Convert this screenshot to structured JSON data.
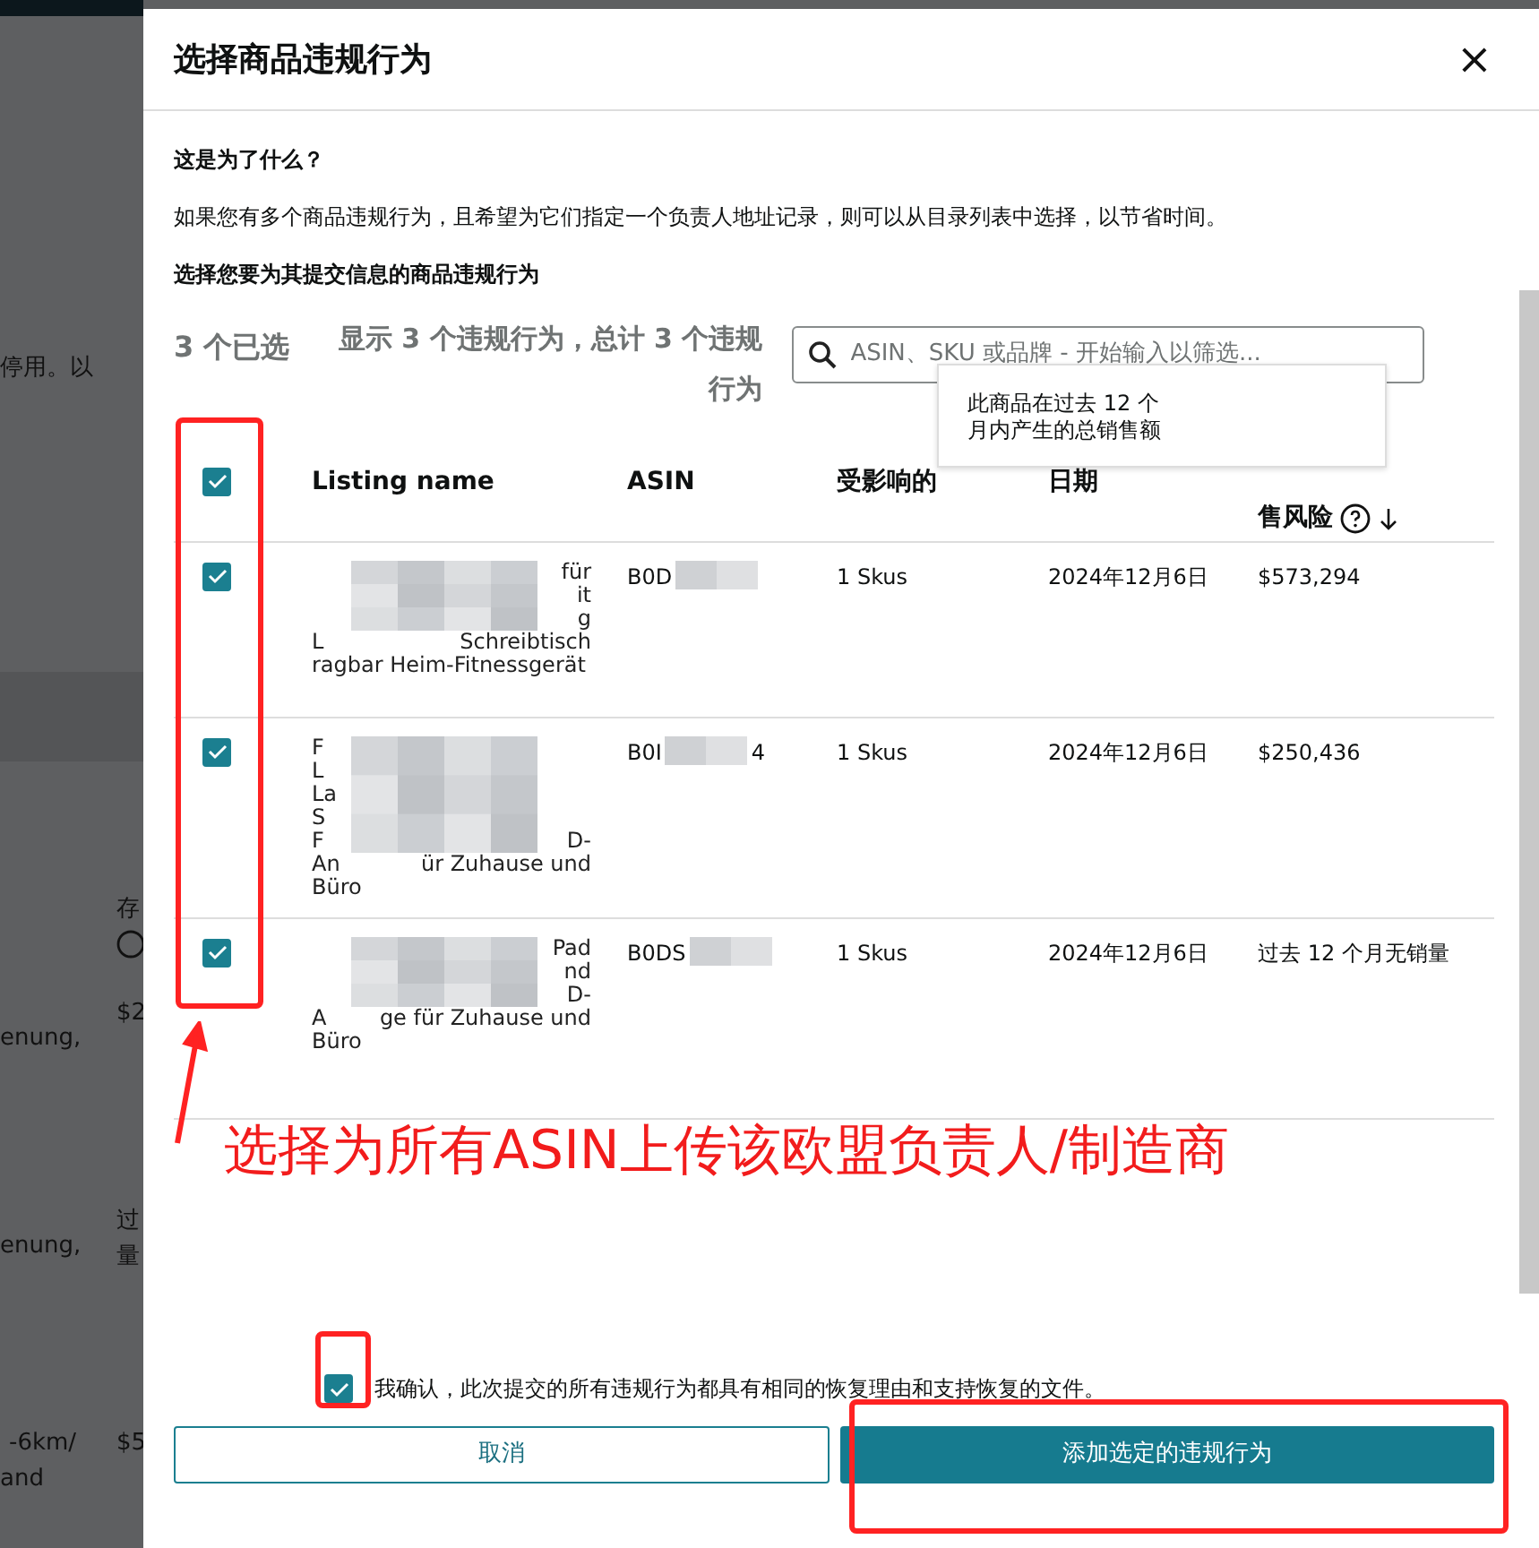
{
  "background_page": {
    "fragments": [
      {
        "text": "停用。以"
      },
      {
        "text": "存"
      },
      {
        "text": "$2"
      },
      {
        "text": "enung,"
      },
      {
        "text": "过"
      },
      {
        "text": "enung,"
      },
      {
        "text": "量"
      },
      {
        "text": "-6km/"
      },
      {
        "text": "$5"
      },
      {
        "text": "and"
      }
    ]
  },
  "modal": {
    "title": "选择商品违规行为",
    "close": "×",
    "why_heading": "这是为了什么？",
    "why_text": "如果您有多个商品违规行为，且希望为它们指定一个负责人地址记录，则可以从目录列表中选择，以节省时间。",
    "select_heading": "选择您要为其提交信息的商品违规行为",
    "selected_count": "3 个已选",
    "showing_count": "显示 3 个违规行为，总计 3 个违规行为",
    "search": {
      "placeholder": "ASIN、SKU 或品牌 - 开始输入以筛选..."
    },
    "tooltip": {
      "lines": [
        "此商品在过去 12 个",
        "月内产生的总销售额"
      ]
    },
    "table": {
      "select_all": {
        "checked": true
      },
      "columns": [
        "Listing name",
        "ASIN",
        "受影响的",
        "日期",
        "售风险"
      ],
      "rows": [
        {
          "checked": true,
          "name_lines": [
            {
              "tail": "für"
            },
            {
              "tail": "it"
            },
            {
              "tail": "g"
            },
            {
              "head": "L",
              "tail": "Schreibtisch"
            },
            {
              "head": "ragbar Heim-Fitnessgerät"
            }
          ],
          "asin": {
            "head": "B0D"
          },
          "skus": "1 Skus",
          "date": "2024年12月6日",
          "risk": "$573,294"
        },
        {
          "checked": true,
          "name_lines": [
            {
              "head": "F"
            },
            {
              "head": "L"
            },
            {
              "head": "La"
            },
            {
              "head": "S"
            },
            {
              "head": "F",
              "tail": "D-"
            },
            {
              "head": "An",
              "tail": "ür Zuhause und"
            },
            {
              "head": "Büro"
            }
          ],
          "asin": {
            "head": "B0I",
            "tail": "4"
          },
          "skus": "1 Skus",
          "date": "2024年12月6日",
          "risk": "$250,436"
        },
        {
          "checked": true,
          "name_lines": [
            {
              "tail": "Pad"
            },
            {
              "tail": "nd"
            },
            {
              "tail": "D-"
            },
            {
              "head": "A",
              "tail": "ge für Zuhause und"
            },
            {
              "head": "Büro"
            }
          ],
          "asin": {
            "head": "B0DS"
          },
          "skus": "1 Skus",
          "date": "2024年12月6日",
          "risk": "过去 12 个月无销量"
        }
      ]
    },
    "confirm": {
      "checked": true,
      "label": "我确认，此次提交的所有违规行为都具有相同的恢复理由和支持恢复的文件。"
    },
    "buttons": [
      {
        "kind": "secondary",
        "label": "取消"
      },
      {
        "kind": "primary",
        "label": "添加选定的违规行为"
      }
    ]
  },
  "annotation": {
    "text": "选择为所有ASIN上传该欧盟负责人/制造商"
  }
}
